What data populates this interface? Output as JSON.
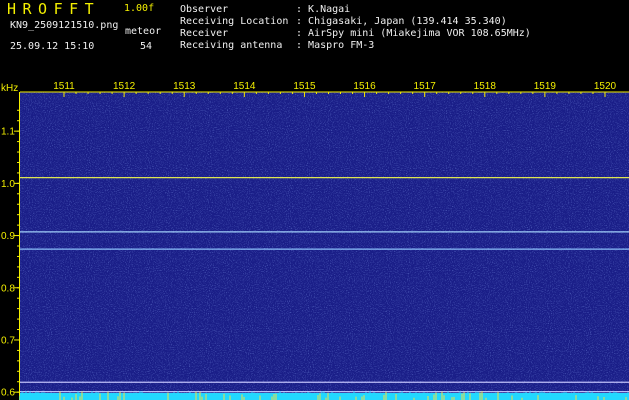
{
  "header": {
    "app_title": "HROFFT",
    "version": "1.00f",
    "filename": "KN9_2509121510.png",
    "mode": "meteor",
    "datetime": "25.09.12 15:10",
    "count": "54"
  },
  "station": [
    {
      "label": "Observer",
      "value": "K.Nagai"
    },
    {
      "label": "Receiving Location",
      "value": "Chigasaki, Japan (139.414 35.340)"
    },
    {
      "label": "Receiver",
      "value": "AirSpy mini (Miakejima VOR 108.65MHz)"
    },
    {
      "label": "Receiving antenna",
      "value": "Maspro FM-3"
    }
  ],
  "axis": {
    "y_unit": "kHz",
    "time_ticks": [
      "1511",
      "1512",
      "1513",
      "1514",
      "1515",
      "1516",
      "1517",
      "1518",
      "1519",
      "1520"
    ],
    "freq_ticks": [
      "1.1",
      "1.0",
      "0.9",
      "0.8",
      "0.7",
      "0.6"
    ],
    "y_range": [
      0.585,
      1.175
    ]
  },
  "signals": [
    {
      "freq_khz": 1.011,
      "color": "#e8f050"
    },
    {
      "freq_khz": 0.907,
      "color": "#a8d8ff"
    },
    {
      "freq_khz": 0.874,
      "color": "#90c8ff"
    },
    {
      "freq_khz": 0.619,
      "color": "#c8c8ff"
    },
    {
      "freq_khz": 0.601,
      "color": "#c8c8ff"
    }
  ],
  "colors": {
    "background": "#1a1e88",
    "axis": "#f4f000",
    "text": "#f0f0f0",
    "noise_floor": "#22d8ff"
  }
}
